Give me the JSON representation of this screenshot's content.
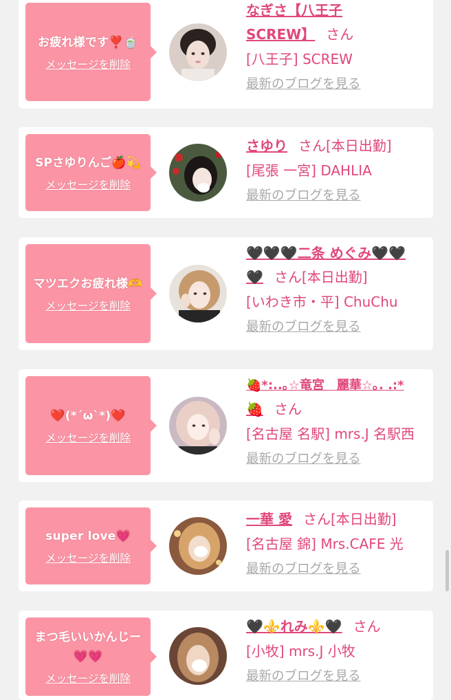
{
  "colors": {
    "background": "#f1f1f1",
    "card": "#ffffff",
    "bubble": "#fb95a5",
    "accent": "#e0477a",
    "link_gray": "#a9a9a9"
  },
  "entries": [
    {
      "message": "お疲れ様です❣️🍵",
      "delete_label": "メッセージを削除",
      "name_line1": "なぎさ【八王子",
      "name_line2": "SCREW】",
      "honorific": "さん",
      "status": "",
      "shop": "[八王子] SCREW",
      "blog_label": "最新のブログを見る",
      "avatar_icon": "avatar-photo"
    },
    {
      "message": "SPさゆりんご🍎💫",
      "delete_label": "メッセージを削除",
      "name_line1": "さゆり",
      "name_line2": "",
      "honorific": "さん",
      "status": "[本日出勤]",
      "shop": "[尾張 一宮] DAHLIA",
      "blog_label": "最新のブログを見る",
      "avatar_icon": "avatar-photo"
    },
    {
      "message": "マツエクお疲れ様🫶",
      "delete_label": "メッセージを削除",
      "name_line1": "🖤🖤🖤二条 めぐみ🖤🖤",
      "name_line2": "🖤",
      "honorific": "さん",
      "status": "[本日出勤]",
      "shop": "[いわき市・平] ChuChu",
      "blog_label": "最新のブログを見る",
      "avatar_icon": "avatar-photo"
    },
    {
      "message": "❤️(*´ω`*)❤️",
      "delete_label": "メッセージを削除",
      "name_line1": "🍓*:..｡☆竜宮　麗華☆｡. .:*",
      "name_line2": "🍓",
      "honorific": "さん",
      "status": "",
      "shop": "[名古屋 名駅] mrs.J 名駅西",
      "blog_label": "最新のブログを見る",
      "avatar_icon": "avatar-photo"
    },
    {
      "message": "super love💗",
      "delete_label": "メッセージを削除",
      "name_line1": "一華 愛",
      "name_line2": "",
      "honorific": "さん",
      "status": "[本日出勤]",
      "shop": "[名古屋 錦] Mrs.CAFE 光",
      "blog_label": "最新のブログを見る",
      "avatar_icon": "avatar-photo"
    },
    {
      "message": "まつ毛いいかんじー💗💗",
      "delete_label": "メッセージを削除",
      "name_line1": "🖤⚜️れみ⚜️🖤",
      "name_line2": "",
      "honorific": "さん",
      "status": "",
      "shop": "[小牧] mrs.J 小牧",
      "blog_label": "最新のブログを見る",
      "avatar_icon": "avatar-photo"
    }
  ]
}
